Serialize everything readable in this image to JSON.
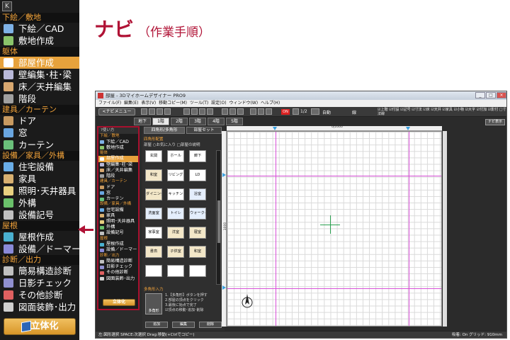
{
  "title": {
    "main": "ナビ",
    "sub": "（作業手順）"
  },
  "nav": {
    "top_icon": "K",
    "sections": [
      {
        "label": "下絵／敷地",
        "items": [
          {
            "label": "下絵／CAD",
            "icon": "image-icon",
            "color": "#7fb2e6"
          },
          {
            "label": "敷地作成",
            "icon": "site-icon",
            "color": "#8bc46a"
          }
        ]
      },
      {
        "label": "躯体",
        "items": [
          {
            "label": "部屋作成",
            "icon": "room-icon",
            "color": "#ffffff",
            "selected": true
          },
          {
            "label": "壁編集･柱･梁",
            "icon": "wall-icon",
            "color": "#b8b8d8"
          },
          {
            "label": "床／天井編集",
            "icon": "floor-icon",
            "color": "#d8a870"
          },
          {
            "label": "階段",
            "icon": "stairs-icon",
            "color": "#a0a0a0"
          }
        ]
      },
      {
        "label": "建具／カーテン",
        "items": [
          {
            "label": "ドア",
            "icon": "door-icon",
            "color": "#c89a60"
          },
          {
            "label": "窓",
            "icon": "window-icon",
            "color": "#6aa6e0"
          },
          {
            "label": "カーテン",
            "icon": "curtain-icon",
            "color": "#6ac07a"
          }
        ]
      },
      {
        "label": "設備／家具／外構",
        "items": [
          {
            "label": "住宅設備",
            "icon": "bath-icon",
            "color": "#6aaee8"
          },
          {
            "label": "家具",
            "icon": "furniture-icon",
            "color": "#d8b070"
          },
          {
            "label": "照明･天井器具",
            "icon": "lamp-icon",
            "color": "#e8d080"
          },
          {
            "label": "外構",
            "icon": "tree-icon",
            "color": "#6ac06a"
          },
          {
            "label": "設備記号",
            "icon": "symbol-icon",
            "color": "#c0c0c0"
          }
        ]
      },
      {
        "label": "屋根",
        "items": [
          {
            "label": "屋根作成",
            "icon": "roof-icon",
            "color": "#4ab0d0"
          },
          {
            "label": "設備／ドーマー",
            "icon": "dormer-icon",
            "color": "#8a8ad8"
          }
        ]
      },
      {
        "label": "診断／出力",
        "items": [
          {
            "label": "簡易構造診断",
            "icon": "structure-icon",
            "color": "#c0c0c0"
          },
          {
            "label": "日影チェック",
            "icon": "shadow-icon",
            "color": "#9090d0"
          },
          {
            "label": "その他診断",
            "icon": "check-icon",
            "color": "#e06060"
          },
          {
            "label": "図面装飾･出力",
            "icon": "print-icon",
            "color": "#d0d0d0"
          }
        ]
      }
    ],
    "bottom_button": "立体化"
  },
  "window": {
    "titlebar": "部屋 - 3Dマイホームデザイナー PRO9",
    "controls": [
      "_",
      "□",
      "×"
    ],
    "menu": "ファイル(F)  編集(E)  表示(V)  移動コピー(M)  ツール(T)  設定(O)  ウィンドウ(W)  ヘルプ(H)",
    "toolbar": {
      "nav_button": "<ナビメニュー",
      "on_label": "ON",
      "scale_label": "1/2",
      "auto_label": "自動",
      "line_label": "線",
      "checks_row1": "☑上階 ☑付設 ☑記号 ☑寸法 ☑床 ☑天井 ☑家具 ☑小物 ☑大字 ☑付加 ☑影付 □寸法線",
      "checks_row2": ""
    },
    "floor_tabs": [
      "地下",
      "1階",
      "2階",
      "3階",
      "4階",
      "5階"
    ],
    "display_button": "ナビ表示",
    "mini_nav": {
      "header": "?使い方",
      "sections": [
        {
          "label": "下絵／敷地",
          "items": [
            "下絵／CAD",
            "敷地作成"
          ]
        },
        {
          "label": "躯体",
          "items": [
            "部屋作成",
            "壁編集･柱･梁",
            "床／天井編集",
            "階段"
          ]
        },
        {
          "label": "建具／カーテン",
          "items": [
            "ドア",
            "窓",
            "カーテン"
          ]
        },
        {
          "label": "設備／家具／外構",
          "items": [
            "住宅設備",
            "家具",
            "照明･天井器具",
            "外構",
            "設備記号"
          ]
        },
        {
          "label": "屋根",
          "items": [
            "屋根作成",
            "設備／ドーマー"
          ]
        },
        {
          "label": "診断／出力",
          "items": [
            "簡易構造診断",
            "日影チェック",
            "その他診断",
            "図面装飾･出力"
          ]
        }
      ],
      "button": "立体化"
    },
    "palette": {
      "tabs": [
        "四角形/多角形",
        "部屋セット"
      ],
      "header": "四角形配置",
      "options": "部屋    ○お気に入り   □部屋の説明",
      "rooms": [
        [
          "玄関",
          "ホール",
          "廊下"
        ],
        [
          "和室",
          "リビング",
          "LD"
        ],
        [
          "ダイニング",
          "キッチン",
          "浴室"
        ],
        [
          "洗面室",
          "トイレ",
          "ウォークイン"
        ],
        [
          "家事室",
          "洋室",
          "寝室"
        ],
        [
          "書斎",
          "子供室",
          "和室"
        ],
        [
          "",
          "",
          ""
        ]
      ],
      "room_colors": [
        "#ffffff",
        "#ffffff",
        "#ffffff",
        "#f3e7c8",
        "#ffffff",
        "#ffffff",
        "#f3e7c8",
        "#ffffff",
        "#e4eefc",
        "#e4eefc",
        "#e4eefc",
        "#e4eefc",
        "#ffffff",
        "#f3e7c8",
        "#f3e7c8",
        "#f3e7c8",
        "#f3e7c8",
        "#f3e7c8",
        "#ffffff",
        "#ffffff",
        "#ffffff"
      ],
      "poly_header": "多角形入力",
      "poly_label": "多角形",
      "poly_text": [
        "1.【多角形】ボタンを押す",
        "2.部屋の頂点をクリック",
        "3.最後に始点で完了",
        "☑頂点の移動･追加･削除"
      ],
      "buttons": [
        "追加",
        "編集",
        "削除"
      ]
    },
    "ruler_top_label": "0|1000",
    "ruler_left_label": "1000",
    "status": "左:図形選択 SPACE:次選択 Drag:移動(+Ctrlでコピー)",
    "status_right": "吸着: On  グリッド: 910mm"
  }
}
